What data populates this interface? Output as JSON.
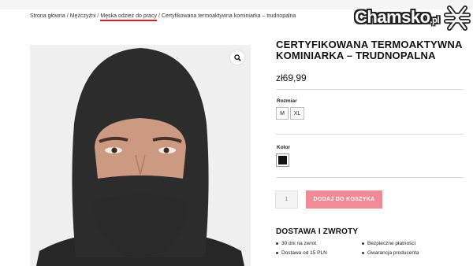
{
  "breadcrumb": {
    "items": [
      "Strona główna",
      "Mężczyźni",
      "Męska odzież do pracy",
      "Certyfikowana termoaktywna kominiarka – trudnopalna"
    ],
    "separator": "/"
  },
  "logo": {
    "main": "Chamsko",
    "suffix": ".pl"
  },
  "product": {
    "title": "CERTYFIKOWANA TERMOAKTYWNA KOMINIARKA – TRUDNOPALNA",
    "price": "zł69,99",
    "size_label": "Rozmiar",
    "sizes": [
      "M",
      "XL"
    ],
    "color_label": "Kolor",
    "color_swatch": "#111111",
    "quantity": "1",
    "add_to_cart": "DODAJ DO KOSZYKA"
  },
  "shipping": {
    "title": "DOSTAWA I ZWROTY",
    "features": [
      "30 dni na zwrot",
      "Bezpieczne płatności",
      "Dostawa od 15 PLN",
      "Gwarancja producenta"
    ]
  },
  "colors": {
    "accent": "#f08a95",
    "highlight_underline": "#d21f1f"
  }
}
